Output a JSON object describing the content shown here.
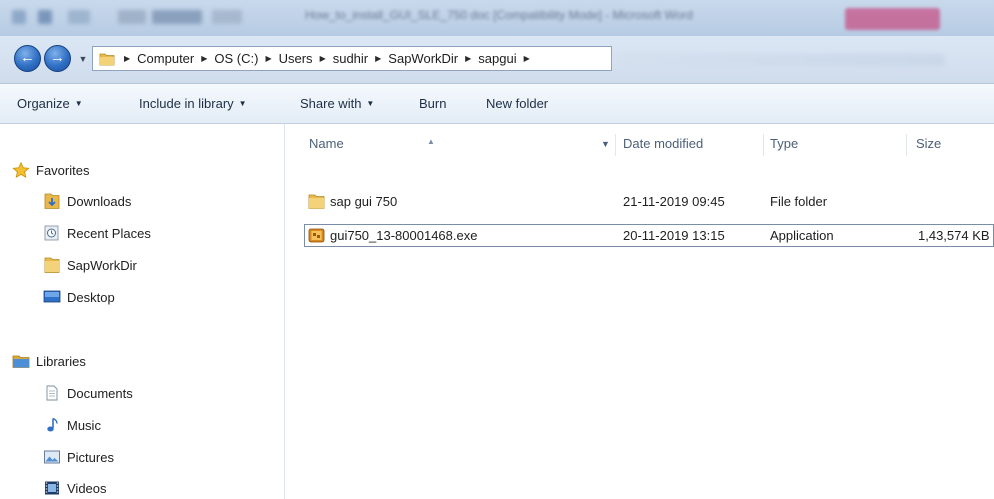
{
  "window": {
    "title": "How_to_install_GUI_SLE_750 doc [Compatibility Mode] - Microsoft Word"
  },
  "address_bar": {
    "breadcrumbs": [
      "Computer",
      "OS (C:)",
      "Users",
      "sudhir",
      "SapWorkDir",
      "sapgui"
    ]
  },
  "toolbar": {
    "organize": "Organize",
    "include_in_library": "Include in library",
    "share_with": "Share with",
    "burn": "Burn",
    "new_folder": "New folder"
  },
  "nav": {
    "favorites_header": "Favorites",
    "favorites": [
      "Downloads",
      "Recent Places",
      "SapWorkDir",
      "Desktop"
    ],
    "libraries_header": "Libraries",
    "libraries": [
      "Documents",
      "Music",
      "Pictures",
      "Videos"
    ]
  },
  "columns": {
    "name": "Name",
    "date_modified": "Date modified",
    "type": "Type",
    "size": "Size"
  },
  "files": [
    {
      "name": "sap gui 750",
      "date": "21-11-2019 09:45",
      "type": "File folder",
      "size": "",
      "icon": "folder-icon"
    },
    {
      "name": "gui750_13-80001468.exe",
      "date": "20-11-2019 13:15",
      "type": "Application",
      "size": "1,43,574 KB",
      "icon": "installer-icon"
    }
  ],
  "colors": {
    "accent": "#2f6fc4",
    "folder": "#e8b94a"
  }
}
